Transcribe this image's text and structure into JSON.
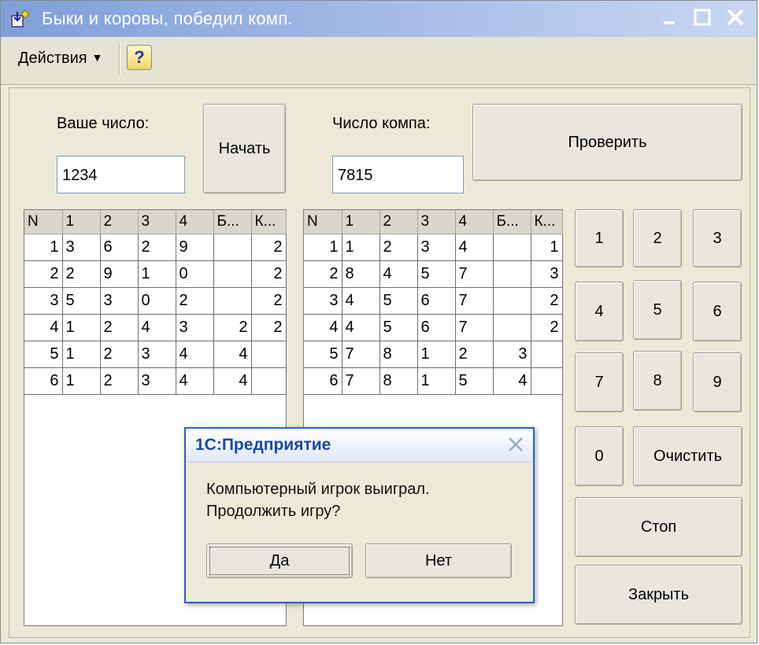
{
  "window": {
    "title": "Быки и коровы, победил комп.",
    "icons": [
      "app-icon",
      "minimize-icon",
      "maximize-icon",
      "close-icon"
    ]
  },
  "toolbar": {
    "actions_label": "Действия",
    "help_label": "?"
  },
  "player": {
    "label": "Ваше число:",
    "value": "1234",
    "start_button": "Начать"
  },
  "computer": {
    "label": "Число компа:",
    "value": "7815",
    "check_button": "Проверить"
  },
  "table_headers": [
    "N",
    "1",
    "2",
    "3",
    "4",
    "Б...",
    "К..."
  ],
  "left_table": {
    "rows": [
      [
        "1",
        "3",
        "6",
        "2",
        "9",
        "",
        "2"
      ],
      [
        "2",
        "2",
        "9",
        "1",
        "0",
        "",
        "2"
      ],
      [
        "3",
        "5",
        "3",
        "0",
        "2",
        "",
        "2"
      ],
      [
        "4",
        "1",
        "2",
        "4",
        "3",
        "2",
        "2"
      ],
      [
        "5",
        "1",
        "2",
        "3",
        "4",
        "4",
        ""
      ],
      [
        "6",
        "1",
        "2",
        "3",
        "4",
        "4",
        ""
      ]
    ]
  },
  "right_table": {
    "rows": [
      [
        "1",
        "1",
        "2",
        "3",
        "4",
        "",
        "1"
      ],
      [
        "2",
        "8",
        "4",
        "5",
        "7",
        "",
        "3"
      ],
      [
        "3",
        "4",
        "5",
        "6",
        "7",
        "",
        "2"
      ],
      [
        "4",
        "4",
        "5",
        "6",
        "7",
        "",
        "2"
      ],
      [
        "5",
        "7",
        "8",
        "1",
        "2",
        "3",
        ""
      ],
      [
        "6",
        "7",
        "8",
        "1",
        "5",
        "4",
        ""
      ]
    ]
  },
  "keypad": {
    "digits": [
      "1",
      "2",
      "3",
      "4",
      "5",
      "6",
      "7",
      "8",
      "9",
      "0"
    ],
    "clear": "Очистить",
    "stop": "Стоп",
    "close": "Закрыть"
  },
  "dialog": {
    "title": "1С:Предприятие",
    "line1": "Компьютерный игрок выиграл.",
    "line2": "Продолжить игру?",
    "yes": "Да",
    "no": "Нет"
  }
}
